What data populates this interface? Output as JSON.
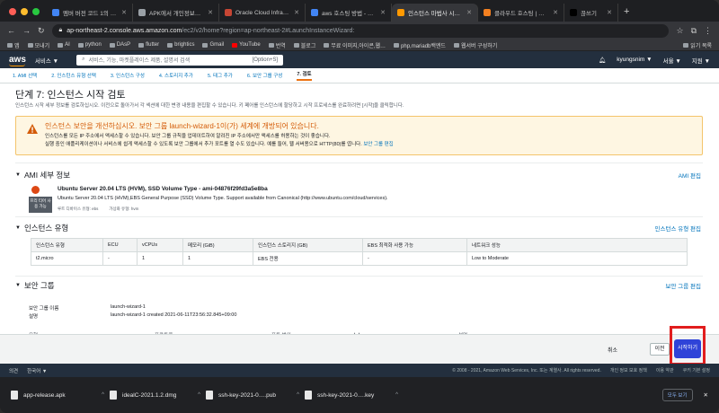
{
  "browser": {
    "tabs": [
      {
        "title": "멤버 버전 코드 1의 APK가 이…",
        "color": "#4285f4"
      },
      {
        "title": "APK에서 개인정보처리 방침…",
        "color": "#9aa0a6"
      },
      {
        "title": "Oracle Cloud Infrastructu…",
        "color": "#c74634"
      },
      {
        "title": "aws 호스팅 방법 - Google…",
        "color": "#4285f4"
      },
      {
        "title": "인스턴스 마법사 시작 | EC2 M…",
        "color": "#ff9900"
      },
      {
        "title": "클라우드 호스팅 | 웹 호스팅 …",
        "color": "#f38020"
      },
      {
        "title": "끊쓰기",
        "color": "#000000"
      }
    ],
    "url_host": "ap-northeast-2.console.aws.amazon.com",
    "url_path": "/ec2/v2/home?region=ap-northeast-2#LaunchInstanceWizard:",
    "bookmarks": [
      "앱",
      "모내기",
      "AI",
      "python",
      "DAsP",
      "flutter",
      "brightics",
      "Gmail",
      "YouTube",
      "번역",
      "블로그",
      "무료 이미지,아이콘,웹…",
      "php,mariadb백엔드",
      "웹서버 구성하기"
    ],
    "reading_list": "읽기 목록"
  },
  "aws": {
    "logo": "aws",
    "services": "서비스 ▼",
    "search_placeholder": "서비스, 기능, 마켓플레이스 제품, 설명서 검색",
    "search_shortcut": "[Option+S]",
    "user": "kyungsnim ▼",
    "region": "서울 ▼",
    "support": "지원 ▼"
  },
  "steps": [
    "1. AMI 선택",
    "2. 인스턴스 유형 선택",
    "3. 인스턴스 구성",
    "4. 스토리지 추가",
    "5. 태그 추가",
    "6. 보안 그룹 구성",
    "7. 검토"
  ],
  "page": {
    "title": "단계 7: 인스턴스 시작 검토",
    "description": "인스턴스 시작 세부 정보를 검토하십시오. 이전으로 돌아가서 각 섹션에 대한 변경 내용을 편집할 수 있습니다. 키 페어를 인스턴스에 할당하고 시작 프로세스를 완료하려면 [시작]을 클릭합니다."
  },
  "warning": {
    "title": "인스턴스 보안을 개선하십시오. 보안 그룹 launch-wizard-1이(가) 세계에 개방되어 있습니다.",
    "line1": "인스턴스를 모든 IP 주소에서 액세스할 수 있습니다. 보안 그룹 규칙을 업데이트하여 알려진 IP 주소에서만 액세스를 허용하는 것이 좋습니다.",
    "line2": "실행 중인 애플리케이션이나 서비스에 쉽게 액세스할 수 있도록 보안 그룹에서 추가 포트를 열 수도 있습니다. 예를 들어, 웹 서버용으로 HTTP(80)를 엽니다.",
    "link": "보안 그룹 편집"
  },
  "ami": {
    "heading": "AMI 세부 정보",
    "edit": "AMI 편집",
    "name": "Ubuntu Server 20.04 LTS (HVM), SSD Volume Type - ami-04876f29fd3a5e8ba",
    "desc": "Ubuntu Server 20.04 LTS (HVM),EBS General Purpose (SSD) Volume Type. Support available from Canonical (http://www.ubuntu.com/cloud/services).",
    "badge": "프리 티어 사용 가능",
    "root_device": "루트 디바이스 유형: ebs",
    "virtualization": "가상화 유형: hvm"
  },
  "instance": {
    "heading": "인스턴스 유형",
    "edit": "인스턴스 유형 편집",
    "columns": [
      "인스턴스 유형",
      "ECU",
      "vCPUs",
      "메모리 (GiB)",
      "인스턴스 스토리지 (GB)",
      "EBS 최적화 사용 가능",
      "네트워크 성능"
    ],
    "row": [
      "t2.micro",
      "-",
      "1",
      "1",
      "EBS 전용",
      "-",
      "Low to Moderate"
    ]
  },
  "security": {
    "heading": "보안 그룹",
    "edit": "보안 그룹 편집",
    "name_label": "보안 그룹 이름",
    "name_value": "launch-wizard-1",
    "desc_label": "설명",
    "desc_value": "launch-wizard-1 created 2021-06-11T23:56:32.845+09:00",
    "rule_columns": [
      "유형",
      "프로토콜",
      "포트 범위",
      "소스",
      "설명"
    ]
  },
  "actions": {
    "cancel": "취소",
    "previous": "이전",
    "launch": "시작하기"
  },
  "console_footer": {
    "feedback": "의견",
    "language": "한국어 ▼",
    "copyright": "© 2008 - 2021, Amazon Web Services, Inc. 또는 계열사. All rights reserved.",
    "privacy": "개인 정보 보호 정책",
    "terms": "이용 약관",
    "cookies": "쿠키 기본 설정"
  },
  "downloads": {
    "files": [
      "app-release.apk",
      "idealC-2021.1.2.dmg",
      "ssh-key-2021-0….pub",
      "ssh-key-2021-0….key"
    ],
    "show_all": "모두 보기"
  },
  "colors": {
    "aws_orange": "#ff9900",
    "aws_nav": "#232f3e",
    "launch_button": "#2f43d8",
    "highlight": "#e11d1d"
  }
}
